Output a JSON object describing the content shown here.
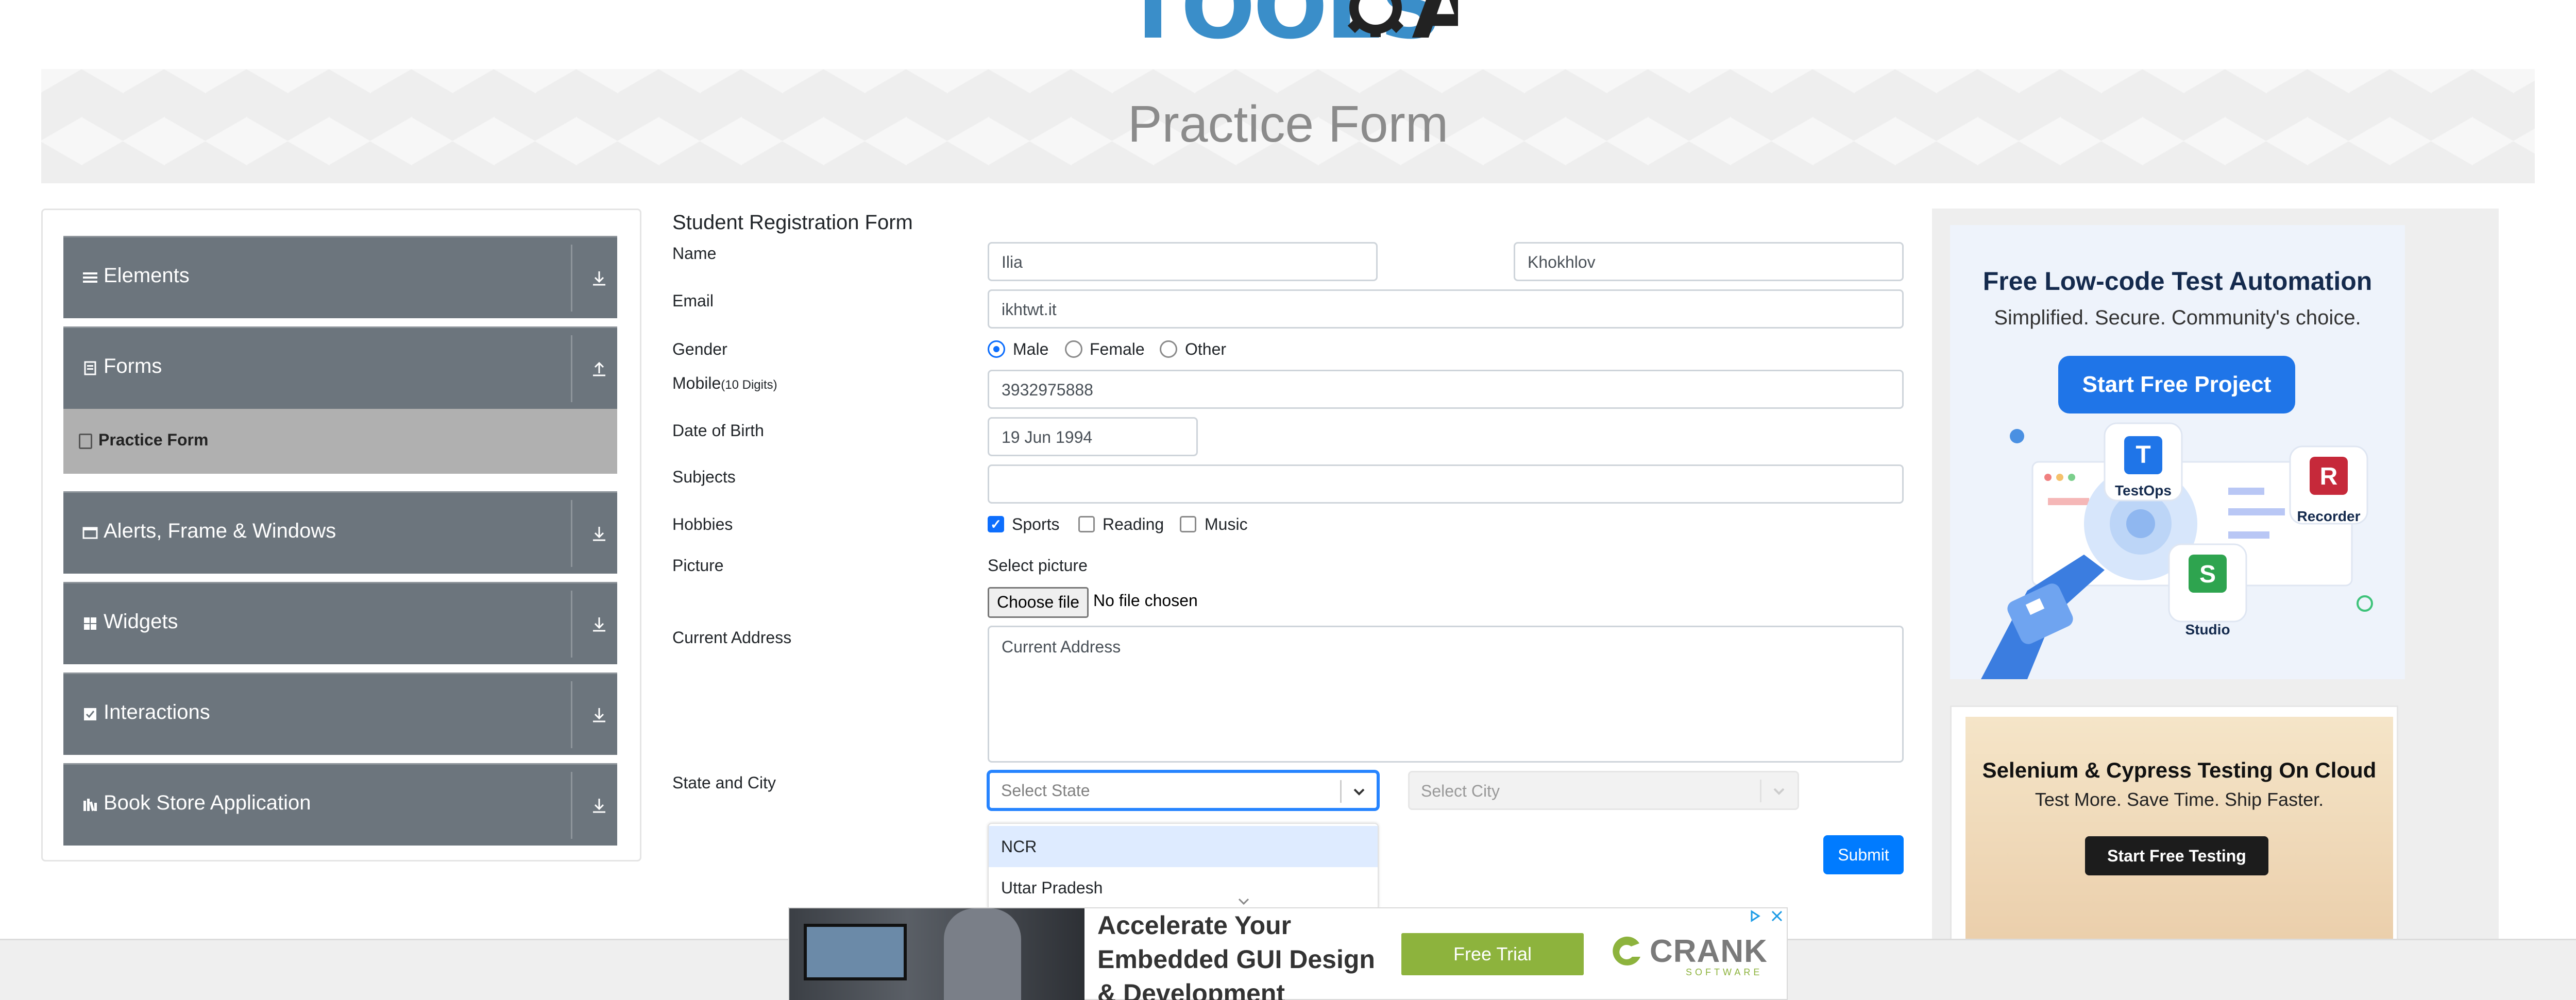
{
  "logo": {
    "text_main": "TOOLS",
    "text_qa": "QA"
  },
  "banner": {
    "title": "Practice Form"
  },
  "sidebar": {
    "groups": [
      {
        "label": "Elements",
        "icon": "hamburger-icon"
      },
      {
        "label": "Forms",
        "icon": "form-icon"
      },
      {
        "label": "Alerts, Frame & Windows",
        "icon": "window-icon"
      },
      {
        "label": "Widgets",
        "icon": "widgets-icon"
      },
      {
        "label": "Interactions",
        "icon": "interactions-icon"
      },
      {
        "label": "Book Store Application",
        "icon": "bookstore-icon"
      }
    ],
    "active_item": "Practice Form"
  },
  "form": {
    "title": "Student Registration Form",
    "labels": {
      "name": "Name",
      "email": "Email",
      "gender": "Gender",
      "mobile": "Mobile",
      "mobile_hint": "(10 Digits)",
      "dob": "Date of Birth",
      "subjects": "Subjects",
      "hobbies": "Hobbies",
      "picture": "Picture",
      "address": "Current Address",
      "state_city": "State and City"
    },
    "first_name": "Ilia",
    "last_name": "Khokhlov",
    "email": "ikhtwt.it",
    "gender_options": [
      "Male",
      "Female",
      "Other"
    ],
    "gender_selected": "Male",
    "mobile": "3932975888",
    "dob": "19 Jun 1994",
    "subjects": "",
    "hobbies": [
      {
        "label": "Sports",
        "checked": true
      },
      {
        "label": "Reading",
        "checked": false
      },
      {
        "label": "Music",
        "checked": false
      }
    ],
    "picture_prompt": "Select picture",
    "choose_file": "Choose file",
    "no_file": "No file chosen",
    "address_placeholder": "Current Address",
    "state_placeholder": "Select State",
    "city_placeholder": "Select City",
    "state_options": [
      "NCR",
      "Uttar Pradesh"
    ],
    "submit": "Submit"
  },
  "ads": {
    "ad1": {
      "title": "Free Low-code Test Automation",
      "subtitle": "Simplified. Secure. Community's choice.",
      "button": "Start Free Project",
      "products": [
        "TestOps",
        "Recorder",
        "Studio"
      ]
    },
    "ad2": {
      "title": "Selenium & Cypress Testing On Cloud",
      "subtitle": "Test More. Save Time. Ship Faster.",
      "button": "Start Free Testing"
    },
    "bottom": {
      "line1": "Accelerate Your",
      "line2": "Embedded GUI Design",
      "line3": "& Development",
      "button": "Free Trial",
      "brand": "CRANK",
      "brand_sub": "SOFTWARE"
    }
  },
  "colors": {
    "primary": "#007bff",
    "menu_bg": "#6c757d",
    "active_item_bg": "#b0b0b0",
    "focus": "#2684ff"
  }
}
